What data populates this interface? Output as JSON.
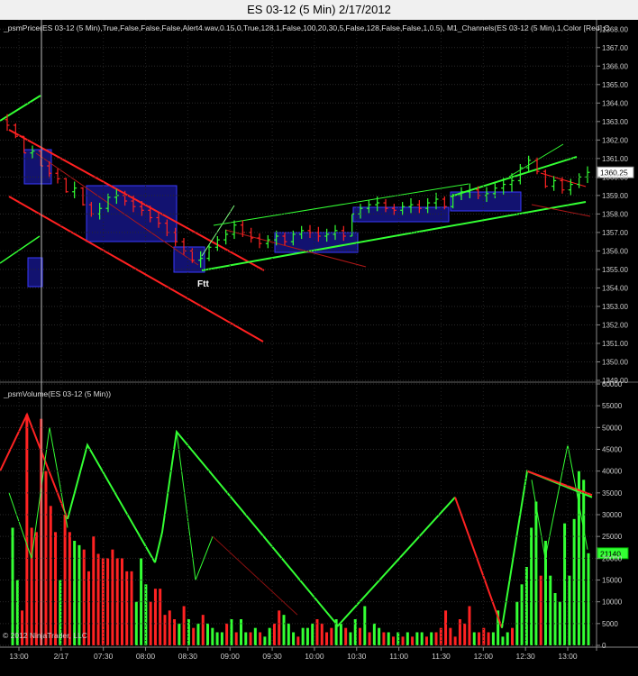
{
  "window": {
    "title": "ES 03-12 (5 Min)  2/17/2012"
  },
  "price_panel": {
    "label": "_psmPrice(ES 03-12 (5 Min),True,False,False,False,Alert4.wav,0.15,0,True,128,1,False,100,20,30,5,False,128,False,False,1,0.5), M1_Channels(ES 03-12 (5 Min),1,Color [Red],C",
    "annotation": "Ftt",
    "last_price_label": "1360.25",
    "y_ticks": [
      "1368.00",
      "1367.00",
      "1366.00",
      "1365.00",
      "1364.00",
      "1363.00",
      "1362.00",
      "1361.00",
      "1360.00",
      "1359.00",
      "1358.00",
      "1357.00",
      "1356.00",
      "1355.00",
      "1354.00",
      "1353.00",
      "1352.00",
      "1351.00",
      "1350.00",
      "1349.00"
    ]
  },
  "volume_panel": {
    "label": "_psmVolume(ES 03-12 (5 Min))",
    "last_volume_label": "21140",
    "y_ticks": [
      "60000",
      "55000",
      "50000",
      "45000",
      "40000",
      "35000",
      "30000",
      "25000",
      "20000",
      "15000",
      "10000",
      "5000",
      "0"
    ]
  },
  "x_ticks": [
    "13:00",
    "2/17",
    "07:30",
    "08:00",
    "08:30",
    "09:00",
    "09:30",
    "10:00",
    "10:30",
    "11:00",
    "11:30",
    "12:00",
    "12:30",
    "13:00"
  ],
  "copyright": "© 2012 NinjaTrader, LLC",
  "colors": {
    "up": "#33ff33",
    "down": "#ff2222",
    "box": "#1a1aa0",
    "background": "#000000"
  },
  "chart_data": [
    {
      "type": "ohlc",
      "title": "ES 03-12 (5 Min)",
      "ylim": [
        1349,
        1368.5
      ],
      "close": [
        1362.8,
        1362.2,
        1361.3,
        1361.4,
        1360.6,
        1360.2,
        1359.9,
        1359.2,
        1359.4,
        1358.5,
        1358.0,
        1358.3,
        1358.9,
        1359.0,
        1358.7,
        1358.4,
        1358.2,
        1357.8,
        1357.5,
        1357.0,
        1356.5,
        1356.0,
        1355.5,
        1355.6,
        1356.2,
        1356.6,
        1356.9,
        1357.4,
        1357.0,
        1356.7,
        1356.4,
        1356.6,
        1356.8,
        1356.5,
        1356.9,
        1357.1,
        1357.0,
        1356.8,
        1356.9,
        1357.1,
        1356.8,
        1358.0,
        1358.3,
        1358.5,
        1358.6,
        1358.3,
        1358.2,
        1358.4,
        1358.5,
        1358.3,
        1358.6,
        1358.8,
        1358.4,
        1359.0,
        1359.2,
        1359.3,
        1359.0,
        1359.1,
        1359.4,
        1359.6,
        1359.8,
        1360.5,
        1360.9,
        1360.3,
        1359.5,
        1359.8,
        1359.3,
        1359.6,
        1360.0,
        1360.25
      ],
      "range": [
        0.9,
        0.8,
        0.9,
        0.7,
        0.8,
        0.9,
        0.8,
        0.8,
        0.9,
        1.0,
        0.8,
        0.9,
        1.0,
        0.8,
        0.8,
        0.9,
        0.8,
        0.9,
        0.8,
        0.9,
        1.0,
        0.9,
        0.8,
        0.9,
        0.9,
        0.8,
        0.8,
        1.0,
        0.9,
        0.8,
        0.8,
        0.7,
        0.8,
        0.7,
        0.8,
        0.7,
        0.7,
        0.8,
        0.7,
        0.8,
        0.8,
        1.0,
        0.8,
        0.7,
        0.8,
        0.7,
        0.6,
        0.7,
        0.8,
        0.7,
        0.8,
        0.9,
        0.7,
        0.8,
        0.7,
        0.8,
        0.7,
        0.8,
        0.8,
        0.9,
        1.0,
        1.1,
        0.9,
        0.9,
        1.0,
        0.8,
        0.9,
        0.9,
        0.8,
        0.9
      ]
    },
    {
      "type": "bar",
      "title": "_psmVolume(ES 03-12 (5 Min))",
      "ylim": [
        0,
        60000
      ],
      "values": [
        27000,
        15000,
        8000,
        53000,
        27000,
        26000,
        52000,
        40000,
        32000,
        26000,
        15000,
        30000,
        26000,
        24000,
        23000,
        22000,
        17000,
        25000,
        21000,
        20000,
        20000,
        22000,
        20000,
        20000,
        17000,
        17000,
        10000,
        20000,
        14000,
        10000,
        13000,
        13000,
        7000,
        8000,
        6000,
        5000,
        9000,
        6000,
        4000,
        5000,
        7000,
        5000,
        4000,
        3000,
        3000,
        5000,
        6000,
        3000,
        6000,
        3000,
        3000,
        4000,
        3000,
        2000,
        4000,
        5000,
        8000,
        7000,
        5000,
        3000,
        2000,
        4000,
        4000,
        5000,
        6000,
        5000,
        3000,
        4000,
        6000,
        5000,
        4000,
        3000,
        6000,
        4000,
        9000,
        3000,
        5000,
        4000,
        3000,
        3000,
        2000,
        3000,
        2000,
        3000,
        2000,
        3000,
        3000,
        2000,
        3000,
        3000,
        4000,
        8000,
        4000,
        2000,
        6000,
        5000,
        9000,
        3000,
        3000,
        4000,
        3000,
        3000,
        8000,
        2000,
        3000,
        4000,
        10000,
        14000,
        18000,
        27000,
        33000,
        16000,
        24000,
        16000,
        12000,
        10000,
        28000,
        16000,
        29000,
        40000,
        38000,
        21140
      ],
      "up": [
        1,
        1,
        0,
        0,
        0,
        0,
        0,
        0,
        0,
        0,
        1,
        0,
        0,
        1,
        1,
        0,
        0,
        0,
        0,
        0,
        0,
        0,
        0,
        0,
        0,
        0,
        1,
        1,
        1,
        0,
        0,
        0,
        0,
        0,
        0,
        1,
        0,
        1,
        0,
        1,
        0,
        1,
        1,
        1,
        1,
        0,
        1,
        0,
        1,
        1,
        0,
        1,
        0,
        1,
        1,
        0,
        0,
        1,
        1,
        1,
        0,
        1,
        1,
        1,
        0,
        0,
        0,
        0,
        1,
        1,
        0,
        1,
        1,
        0,
        1,
        0,
        1,
        1,
        0,
        1,
        0,
        1,
        0,
        1,
        0,
        1,
        1,
        0,
        1,
        0,
        0,
        0,
        0,
        0,
        0,
        0,
        0,
        1,
        0,
        0,
        0,
        1,
        1,
        1,
        1,
        0,
        1,
        1,
        1,
        1,
        1,
        0,
        1,
        1,
        1,
        1,
        1,
        1,
        1,
        1,
        1,
        1
      ]
    }
  ]
}
